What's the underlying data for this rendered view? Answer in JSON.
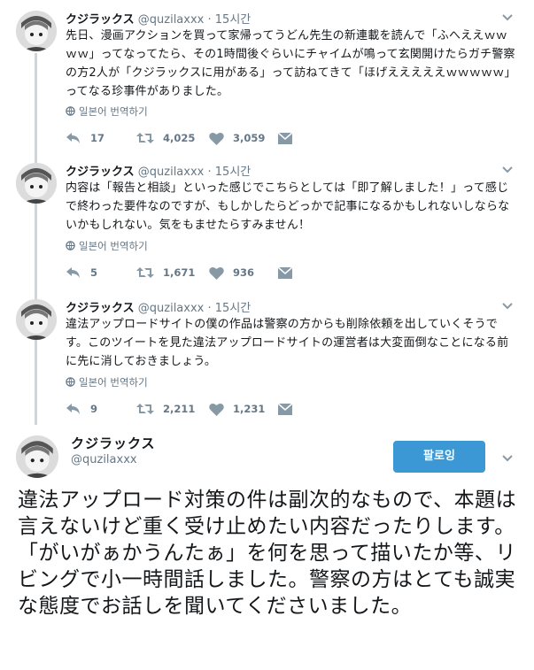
{
  "thread": [
    {
      "name": "クジラックス",
      "handle": "@quzilaxxx",
      "dot": "·",
      "time": "15시간",
      "text": "先日、漫画アクションを買って家帰ってうどん先生の新連載を読んで「ふへええｗｗｗｗ」ってなってたら、その1時間後ぐらいにチャイムが鳴って玄関開けたらガチ警察の方2人が「クジラックスに用がある」って訪ねてきて「ほげえええええｗｗｗｗｗ」ってなる珍事件がありました。",
      "translate": "일본어 번역하기",
      "replies": "17",
      "retweets": "4,025",
      "likes": "3,059"
    },
    {
      "name": "クジラックス",
      "handle": "@quzilaxxx",
      "dot": "·",
      "time": "15시간",
      "text": "内容は「報告と相談」といった感じでこちらとしては「即了解しました！」って感じで終わった要件なのですが、もしかしたらどっかで記事になるかもしれないしならないかもしれない。気をもませたらすみません！",
      "translate": "일본어 번역하기",
      "replies": "5",
      "retweets": "1,671",
      "likes": "936"
    },
    {
      "name": "クジラックス",
      "handle": "@quzilaxxx",
      "dot": "·",
      "time": "15시간",
      "text": "違法アップロードサイトの僕の作品は警察の方からも削除依頼を出していくそうです。このツイートを見た違法アップロードサイトの運営者は大変面倒なことになる前に先に消しておきましょう。",
      "translate": "일본어 번역하기",
      "replies": "9",
      "retweets": "2,211",
      "likes": "1,231"
    }
  ],
  "main": {
    "name": "クジラックス",
    "handle": "@quzilaxxx",
    "follow_label": "팔로잉",
    "text": "違法アップロード対策の件は副次的なもので、本題は言えないけど重く受け止めたい内容だったりします。「がいがぁかうんたぁ」を何を思って描いたか等、リビングで小一時間話しました。警察の方はとても誠実な態度でお話しを聞いてくださいました。"
  },
  "colors": {
    "accent": "#3b98d4",
    "muted": "#657786",
    "thread_line": "#ccd6dd"
  },
  "icons": [
    "reply-icon",
    "retweet-icon",
    "like-icon",
    "dm-icon",
    "globe-icon",
    "chevron-down-icon"
  ]
}
